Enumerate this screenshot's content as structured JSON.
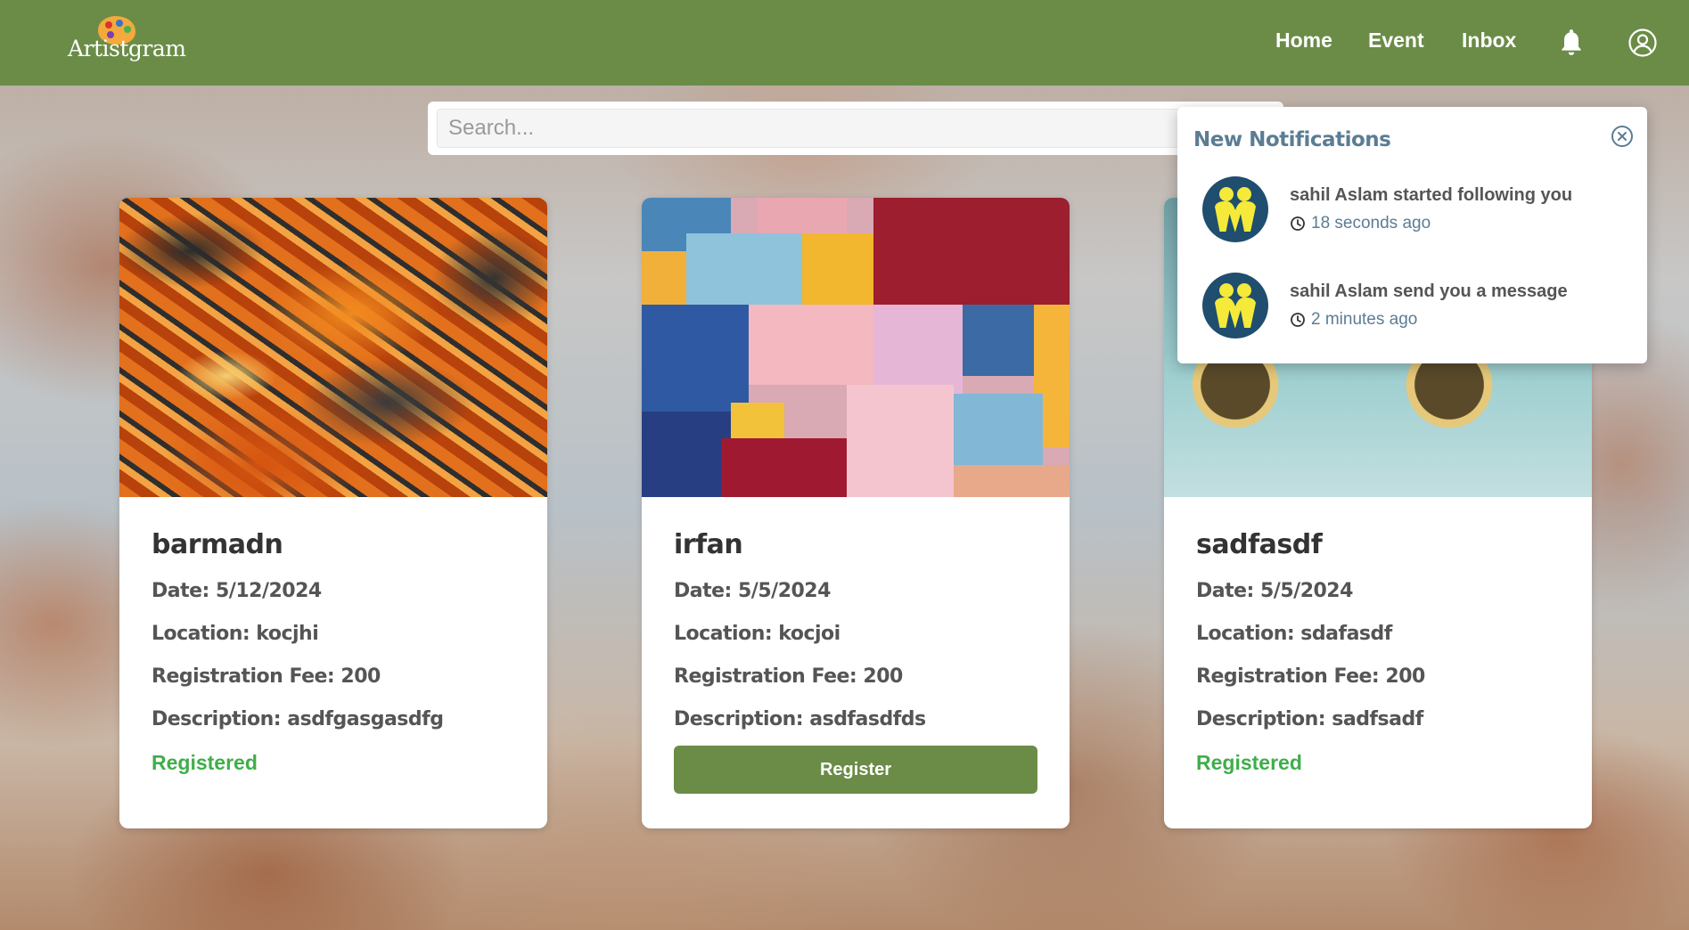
{
  "brand": {
    "name": "Artistgram"
  },
  "nav": {
    "home": "Home",
    "event": "Event",
    "inbox": "Inbox"
  },
  "search": {
    "placeholder": "Search..."
  },
  "events": [
    {
      "name": "barmadn",
      "date": "Date: 5/12/2024",
      "location": "Location: kocjhi",
      "fee": "Registration Fee: 200",
      "description": "Description: asdfgasgasdfg",
      "status": "Registered"
    },
    {
      "name": "irfan",
      "date": "Date: 5/5/2024",
      "location": "Location: kocjoi",
      "fee": "Registration Fee: 200",
      "description": "Description: asdfasdfds",
      "action": "Register"
    },
    {
      "name": "sadfasdf",
      "date": "Date: 5/5/2024",
      "location": "Location: sdafasdf",
      "fee": "Registration Fee: 200",
      "description": "Description: sadfsadf",
      "status": "Registered"
    }
  ],
  "notifications": {
    "title": "New Notifications",
    "items": [
      {
        "text": "sahil Aslam started following you",
        "time": "18 seconds ago"
      },
      {
        "text": "sahil Aslam send you a message",
        "time": "2 minutes ago"
      }
    ]
  },
  "colors": {
    "header": "#6a8c47",
    "registered": "#3fae4a",
    "notif_accent": "#5b7d93"
  }
}
